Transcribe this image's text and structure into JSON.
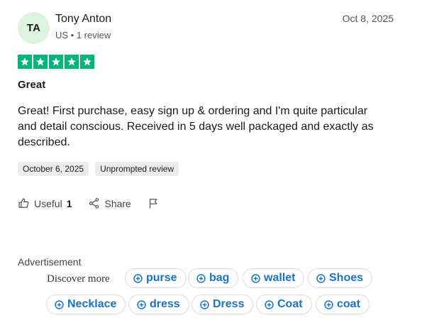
{
  "reviewer": {
    "initials": "TA",
    "name": "Tony Anton",
    "meta": "US • 1 review"
  },
  "review": {
    "date": "Oct 8, 2025",
    "rating": 5,
    "star_color": "#00b67a",
    "title": "Great",
    "body": "Great! First purchase, easy sign up & ordering and I'm quite particular and detail conscious. Received in 5 days well packaged and exactly as described.",
    "experience_date": "October 6, 2025",
    "tag": "Unprompted review"
  },
  "actions": {
    "useful_label": "Useful",
    "useful_count": "1",
    "share_label": "Share"
  },
  "ads": {
    "label": "Advertisement",
    "discover_label": "Discover more",
    "chip_color": "#1a73c9",
    "chips": [
      "purse",
      "bag",
      "wallet",
      "Shoes",
      "Necklace",
      "dress",
      "Dress",
      "Coat",
      "coat"
    ]
  }
}
